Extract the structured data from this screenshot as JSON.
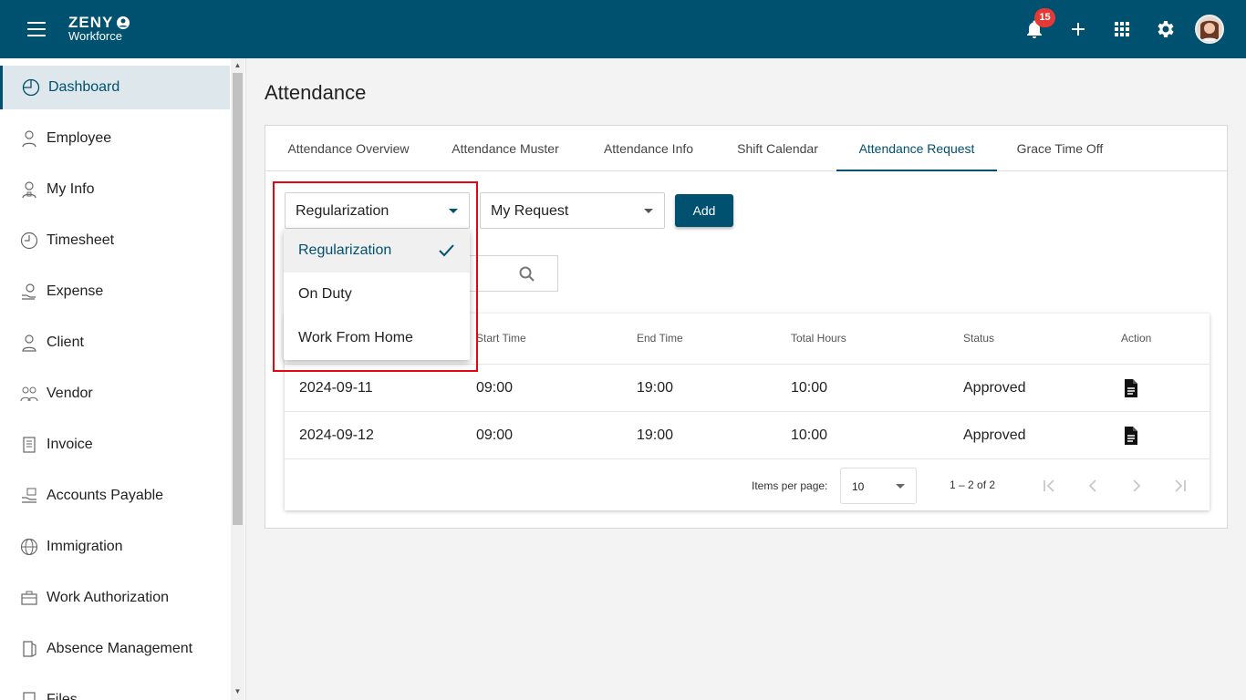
{
  "header": {
    "logo_brand": "ZENY",
    "logo_sub": "Workforce",
    "notification_count": "15",
    "icons": [
      "menu-icon",
      "bell-icon",
      "plus-icon",
      "apps-grid-icon",
      "gear-icon",
      "avatar"
    ]
  },
  "sidebar": {
    "items": [
      {
        "label": "Dashboard",
        "icon": "dashboard-icon",
        "active": true
      },
      {
        "label": "Employee",
        "icon": "employee-icon"
      },
      {
        "label": "My Info",
        "icon": "user-info-icon"
      },
      {
        "label": "Timesheet",
        "icon": "clock-icon"
      },
      {
        "label": "Expense",
        "icon": "expense-icon"
      },
      {
        "label": "Client",
        "icon": "person-icon"
      },
      {
        "label": "Vendor",
        "icon": "vendor-icon"
      },
      {
        "label": "Invoice",
        "icon": "invoice-icon"
      },
      {
        "label": "Accounts Payable",
        "icon": "payable-icon"
      },
      {
        "label": "Immigration",
        "icon": "globe-icon"
      },
      {
        "label": "Work Authorization",
        "icon": "briefcase-icon"
      },
      {
        "label": "Absence Management",
        "icon": "door-icon"
      },
      {
        "label": "Files",
        "icon": "file-icon"
      }
    ]
  },
  "page": {
    "title": "Attendance"
  },
  "tabs": [
    {
      "label": "Attendance Overview"
    },
    {
      "label": "Attendance Muster"
    },
    {
      "label": "Attendance Info"
    },
    {
      "label": "Shift Calendar"
    },
    {
      "label": "Attendance Request",
      "active": true
    },
    {
      "label": "Grace Time Off"
    }
  ],
  "filters": {
    "request_type_value": "Regularization",
    "scope_value": "My Request",
    "add_label": "Add"
  },
  "dropdown": {
    "options": [
      {
        "label": "Regularization",
        "selected": true
      },
      {
        "label": "On Duty"
      },
      {
        "label": "Work From Home"
      }
    ]
  },
  "table": {
    "headers": [
      "Start Time",
      "End Time",
      "Total Hours",
      "Status",
      "Action"
    ],
    "rows": [
      {
        "date": "2024-09-11",
        "start": "09:00",
        "end": "19:00",
        "total": "10:00",
        "status": "Approved"
      },
      {
        "date": "2024-09-12",
        "start": "09:00",
        "end": "19:00",
        "total": "10:00",
        "status": "Approved"
      }
    ]
  },
  "paginator": {
    "items_per_page_label": "Items per page:",
    "page_size": "10",
    "range": "1 – 2 of 2"
  },
  "colors": {
    "primary": "#00506f",
    "accent": "#f39b1b",
    "badge": "#e53935",
    "highlight": "#e30613"
  }
}
